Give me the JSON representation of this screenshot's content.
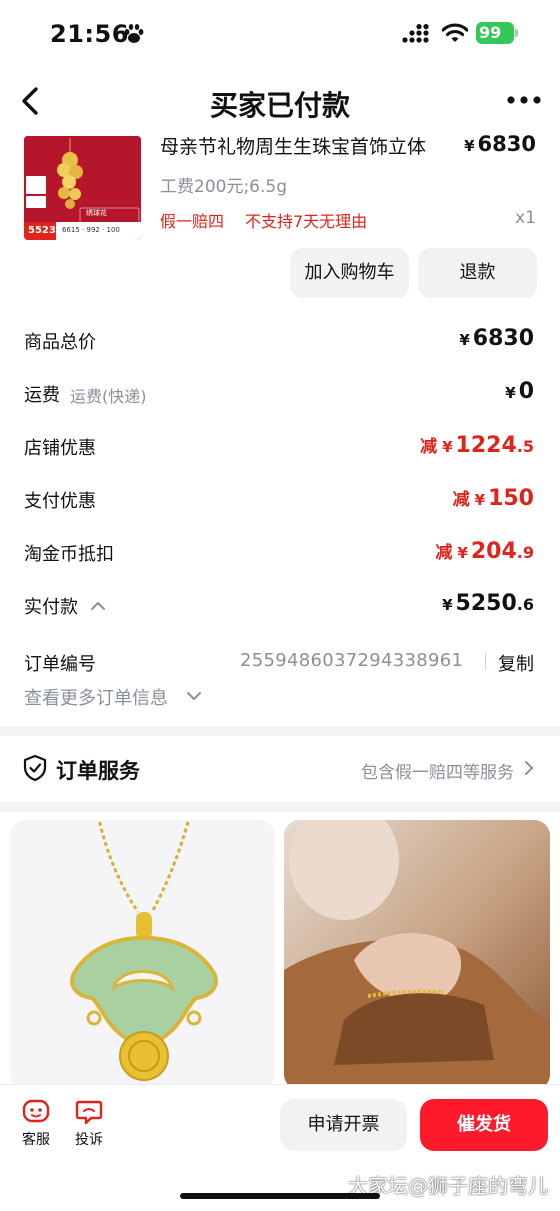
{
  "status_bar": {
    "time": "21:56",
    "battery": "99"
  },
  "nav": {
    "title": "买家已付款"
  },
  "product": {
    "title": "母亲节礼物周生生珠宝首饰立体",
    "price_symbol": "¥",
    "price": "6830",
    "spec": "工费200元;6.5g",
    "tag_1": "假一赔四",
    "tag_2": "不支持7天无理由",
    "quantity": "x1",
    "thumb_text": {
      "price": "5523",
      "product_name": "绣球花",
      "numbers": "6615  ·  992  ·  100"
    }
  },
  "actions": {
    "add_to_cart": "加入购物车",
    "refund": "退款"
  },
  "price_rows": {
    "total": {
      "label": "商品总价",
      "symbol": "¥",
      "value": "6830"
    },
    "shipping": {
      "label": "运费",
      "sub": "运费(快递)",
      "symbol": "¥",
      "value": "0"
    },
    "shop_discount": {
      "label": "店铺优惠",
      "prefix": "减",
      "symbol": "¥",
      "value": "1224",
      "decimal": ".5"
    },
    "pay_discount": {
      "label": "支付优惠",
      "prefix": "减",
      "symbol": "¥",
      "value": "150"
    },
    "coin_deduct": {
      "label": "淘金币抵扣",
      "prefix": "减",
      "symbol": "¥",
      "value": "204",
      "decimal": ".9"
    },
    "paid": {
      "label": "实付款",
      "symbol": "¥",
      "value": "5250",
      "decimal": ".6"
    }
  },
  "order": {
    "number_label": "订单编号",
    "number": "2559486037294338961",
    "copy_label": "复制",
    "more_info": "查看更多订单信息"
  },
  "service": {
    "title": "订单服务",
    "desc": "包含假一赔四等服务"
  },
  "bottom": {
    "customer_service": "客服",
    "complain": "投诉",
    "invoice": "申请开票",
    "urge": "催发货"
  },
  "watermark": "大家坛@狮子座的弯儿",
  "colors": {
    "accent_red": "#e0241b",
    "urge_button": "#ff1a2b",
    "battery_green": "#34c759",
    "muted_text": "#8a8f99"
  },
  "icons": {
    "status": [
      "paw-icon",
      "signal-icon",
      "wifi-icon",
      "battery-icon"
    ],
    "nav": [
      "back-icon",
      "more-icon"
    ],
    "service": "shield-check-icon",
    "bottom": [
      "customer-service-icon",
      "complain-icon"
    ]
  }
}
